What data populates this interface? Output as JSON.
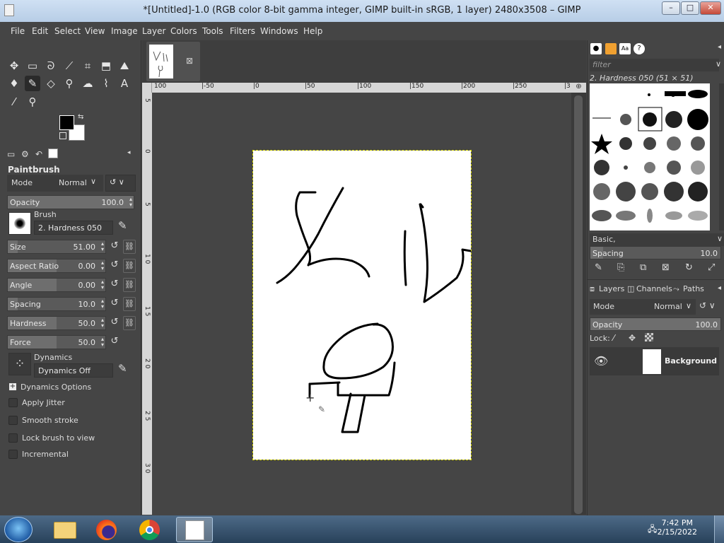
{
  "window": {
    "title": "*[Untitled]-1.0 (RGB color 8-bit gamma integer, GIMP built-in sRGB, 1 layer) 2480x3508 – GIMP",
    "controls": [
      "–",
      "□",
      "✕"
    ]
  },
  "menu": [
    "File",
    "Edit",
    "Select",
    "View",
    "Image",
    "Layer",
    "Colors",
    "Tools",
    "Filters",
    "Windows",
    "Help"
  ],
  "tool_options": {
    "name": "Paintbrush",
    "mode_label": "Mode",
    "mode_value": "Normal",
    "opacity": {
      "label": "Opacity",
      "value": "100.0",
      "fraction": 1.0
    },
    "brush_label": "Brush",
    "brush_value": "2. Hardness 050",
    "size": {
      "label": "Size",
      "value": "51.00",
      "fraction": 0.1
    },
    "aspect": {
      "label": "Aspect Ratio",
      "value": "0.00",
      "fraction": 0.5
    },
    "angle": {
      "label": "Angle",
      "value": "0.00",
      "fraction": 0.5
    },
    "spacing": {
      "label": "Spacing",
      "value": "10.0",
      "fraction": 0.1
    },
    "hardness": {
      "label": "Hardness",
      "value": "50.0",
      "fraction": 0.5
    },
    "force": {
      "label": "Force",
      "value": "50.0",
      "fraction": 0.5
    },
    "dynamics_label": "Dynamics",
    "dynamics_value": "Dynamics Off",
    "dynamics_options": "Dynamics Options",
    "apply_jitter": "Apply Jitter",
    "smooth_stroke": "Smooth stroke",
    "lock_brush": "Lock brush to view",
    "incremental": "Incremental"
  },
  "ruler": {
    "h_labels": [
      "100",
      "|-50",
      "|0",
      "|50",
      "|100",
      "|150",
      "|200",
      "|250",
      "|3"
    ],
    "v_labels": [
      "5",
      "0",
      "5",
      "1 0",
      "1 5",
      "2 0",
      "2 5",
      "3 0"
    ]
  },
  "dock": {
    "filter_placeholder": "filter",
    "brush_title": "2. Hardness 050 (51 × 51)",
    "preset": "Basic,",
    "spacing": {
      "label": "Spacing",
      "value": "10.0",
      "fraction": 0.1
    },
    "tabs": [
      "Layers",
      "Channels",
      "Paths"
    ],
    "mode_label": "Mode",
    "mode_value": "Normal",
    "opacity": {
      "label": "Opacity",
      "value": "100.0",
      "fraction": 1.0
    },
    "lock_label": "Lock:",
    "layer_name": "Background"
  },
  "taskbar": {
    "time": "7:42 PM",
    "date": "2/15/2022"
  },
  "colors": {
    "foreground": "#000000",
    "background": "#ffffff",
    "accent": "#d8d800"
  }
}
